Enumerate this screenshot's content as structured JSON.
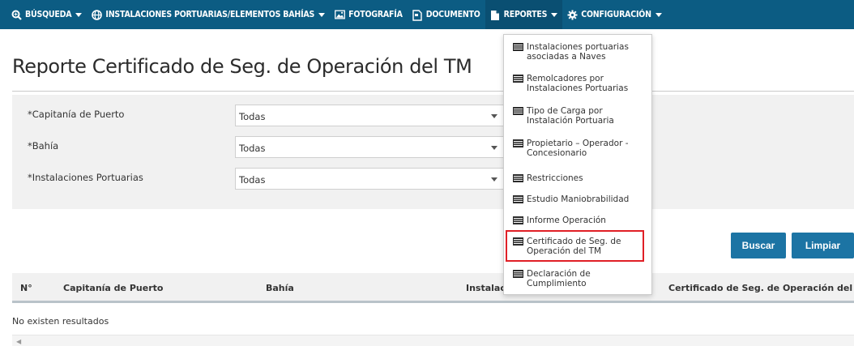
{
  "nav": {
    "items": [
      {
        "label": "BÚSQUEDA",
        "icon": "search-icon",
        "caret": true
      },
      {
        "label": "INSTALACIONES PORTUARIAS/ELEMENTOS BAHÍAS",
        "icon": "globe-icon",
        "caret": true
      },
      {
        "label": "FOTOGRAFÍA",
        "icon": "image-icon",
        "caret": false
      },
      {
        "label": "DOCUMENTO",
        "icon": "document-icon",
        "caret": false
      },
      {
        "label": "REPORTES",
        "icon": "file-icon",
        "caret": true,
        "active": true
      },
      {
        "label": "CONFIGURACIÓN",
        "icon": "gear-icon",
        "caret": true
      }
    ],
    "bg_color": "#0c5c83"
  },
  "page": {
    "title": "Reporte Certificado de Seg. de Operación del TM"
  },
  "filters": [
    {
      "label": "*Capitanía de Puerto",
      "value": "Todas"
    },
    {
      "label": "*Bahía",
      "value": "Todas"
    },
    {
      "label": "*Instalaciones Portuarias",
      "value": "Todas"
    }
  ],
  "buttons": {
    "search": "Buscar",
    "clear": "Limpiar",
    "color": "#1c74a4"
  },
  "table": {
    "columns": [
      "N°",
      "Capitanía de Puerto",
      "Bahía",
      "Instalac",
      "Certificado de Seg. de Operación del TM"
    ],
    "empty_message": "No existen resultados"
  },
  "reportes_menu": {
    "items": [
      "Instalaciones portuarias asociadas a Naves",
      "Remolcadores por Instalaciones Portuarias",
      "Tipo de Carga por Instalación Portuaria",
      "Propietario – Operador - Concesionario",
      "Restricciones",
      "Estudio Maniobrabilidad",
      "Informe Operación",
      "Certificado de Seg. de Operación del TM",
      "Declaración de Cumplimiento"
    ],
    "highlighted": "Certificado de Seg. de Operación del TM",
    "highlight_color": "#e01f26",
    "item_icon": "report-icon"
  }
}
